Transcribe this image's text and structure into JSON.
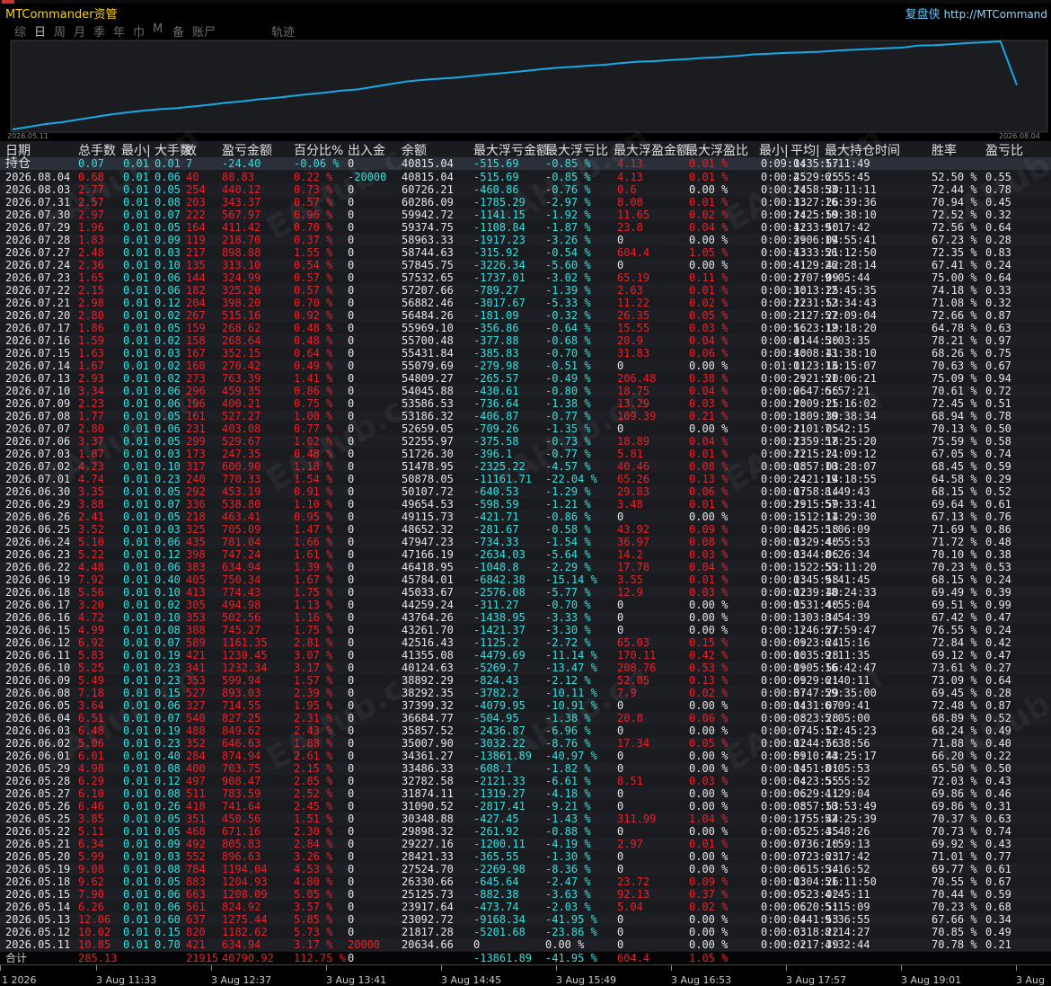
{
  "header": {
    "app_title": "MTCommander资管",
    "brand_name": "复盘侠",
    "brand_url": "http://MTCommand"
  },
  "tabs": [
    "综",
    "日",
    "周",
    "月",
    "季",
    "年",
    "巾",
    "M",
    "备",
    "账尸",
    "轨迹"
  ],
  "active_tab": 1,
  "chart": {
    "start_label": "2026.05.11",
    "end_label": "2026.08.04",
    "line_color": "#17a9e8"
  },
  "columns": [
    "日期",
    "总手数",
    "最小|",
    "大手数",
    "数",
    "盈亏金额",
    "百分比%",
    "出入金",
    "余额",
    "最大浮亏金额",
    "最大浮亏比",
    "最大浮盈金额",
    "最大浮盈比",
    "最小|",
    "平均|",
    "最大持仓时间",
    "胜率",
    "盈亏比"
  ],
  "watermark": "EAHub.cn",
  "hold": [
    "持仓",
    "0.07",
    "0.01",
    "0.01",
    "7",
    "-24.40",
    "-0.06 %",
    "0",
    "40815.04",
    "-515.69",
    "-0.85 %",
    "4.13",
    "0.01 %",
    "0:09:14",
    "0:35:57",
    "1:11:49",
    "",
    ""
  ],
  "rows": [
    [
      "2026.08.04",
      "0.68",
      "0.01",
      "0.06",
      "40",
      "88.83",
      "0.22 %",
      "-20000",
      "40815.04",
      "-515.69",
      "-0.85 %",
      "4.13",
      "0.01 %",
      "0:00:45",
      "2:29:25",
      "6:55:45",
      "52.50 %",
      "0.55"
    ],
    [
      "2026.08.03",
      "2.77",
      "0.01",
      "0.05",
      "254",
      "440.12",
      "0.73 %",
      "0",
      "60726.21",
      "-460.86",
      "-0.76 %",
      "0.6",
      "0.00 %",
      "0:00:24",
      "1:58:30",
      "53:11:11",
      "72.44 %",
      "0.78"
    ],
    [
      "2026.07.31",
      "2.57",
      "0.01",
      "0.08",
      "203",
      "343.37",
      "0.57 %",
      "0",
      "60286.09",
      "-1785.29",
      "-2.97 %",
      "8.08",
      "0.01 %",
      "0:00:33",
      "1:27:26",
      "16:39:36",
      "70.94 %",
      "0.45"
    ],
    [
      "2026.07.30",
      "2.97",
      "0.01",
      "0.07",
      "222",
      "567.97",
      "0.96 %",
      "0",
      "59942.72",
      "-1141.15",
      "-1.92 %",
      "11.65",
      "0.02 %",
      "0:00:24",
      "1:25:59",
      "10:38:10",
      "72.52 %",
      "0.32"
    ],
    [
      "2026.07.29",
      "1.96",
      "0.01",
      "0.05",
      "164",
      "411.42",
      "0.70 %",
      "0",
      "59374.75",
      "-1108.84",
      "-1.87 %",
      "23.8",
      "0.04 %",
      "0:00:42",
      "1:33:50",
      "9:17:42",
      "72.56 %",
      "0.64"
    ],
    [
      "2026.07.28",
      "1.83",
      "0.01",
      "0.09",
      "119",
      "218.70",
      "0.37 %",
      "0",
      "58963.33",
      "-1917.23",
      "-3.26 %",
      "0",
      "0.00 %",
      "0:00:29",
      "3:06:04",
      "19:55:41",
      "67.23 %",
      "0.28"
    ],
    [
      "2026.07.27",
      "2.48",
      "0.01",
      "0.03",
      "217",
      "898.88",
      "1.55 %",
      "0",
      "58744.63",
      "-315.92",
      "-0.54 %",
      "604.4",
      "1.05 %",
      "0:00:13",
      "4:33:21",
      "56:12:50",
      "72.35 %",
      "0.83"
    ],
    [
      "2026.07.24",
      "2.36",
      "0.01",
      "0.10",
      "135",
      "313.10",
      "0.54 %",
      "0",
      "57845.75",
      "-3226.34",
      "-5.60 %",
      "0",
      "0.00 %",
      "0:00:41",
      "4:29:42",
      "26:28:14",
      "67.41 %",
      "0.24"
    ],
    [
      "2026.07.23",
      "1.65",
      "0.01",
      "0.06",
      "144",
      "324.99",
      "0.57 %",
      "0",
      "57532.65",
      "-1737.01",
      "-3.02 %",
      "65.19",
      "0.11 %",
      "0:00:27",
      "1:07:09",
      "9:05:44",
      "75.00 %",
      "0.64"
    ],
    [
      "2026.07.22",
      "2.15",
      "0.01",
      "0.06",
      "182",
      "325.20",
      "0.57 %",
      "0",
      "57207.66",
      "-789.27",
      "-1.39 %",
      "2.63",
      "0.01 %",
      "0:00:30",
      "1:13:25",
      "12:45:35",
      "74.18 %",
      "0.33"
    ],
    [
      "2026.07.21",
      "2.98",
      "0.01",
      "0.12",
      "204",
      "398.20",
      "0.70 %",
      "0",
      "56882.46",
      "-3017.67",
      "-5.33 %",
      "11.22",
      "0.02 %",
      "0:00:22",
      "1:31:53",
      "12:34:43",
      "71.08 %",
      "0.32"
    ],
    [
      "2026.07.20",
      "2.80",
      "0.01",
      "0.02",
      "267",
      "515.16",
      "0.92 %",
      "0",
      "56484.26",
      "-181.09",
      "-0.32 %",
      "26.35",
      "0.05 %",
      "0:00:21",
      "2:27:22",
      "57:09:04",
      "72.66 %",
      "0.87"
    ],
    [
      "2026.07.17",
      "1.86",
      "0.01",
      "0.05",
      "159",
      "268.62",
      "0.48 %",
      "0",
      "55969.10",
      "-356.86",
      "-0.64 %",
      "15.55",
      "0.03 %",
      "0:00:56",
      "1:23:19",
      "12:18:20",
      "64.78 %",
      "0.63"
    ],
    [
      "2026.07.16",
      "1.59",
      "0.01",
      "0.02",
      "158",
      "268.64",
      "0.48 %",
      "0",
      "55700.48",
      "-377.88",
      "-0.68 %",
      "20.9",
      "0.04 %",
      "0:00:41",
      "0:44:30",
      "5:03:35",
      "78.21 %",
      "0.97"
    ],
    [
      "2026.07.15",
      "1.63",
      "0.01",
      "0.03",
      "167",
      "352.15",
      "0.64 %",
      "0",
      "55431.84",
      "-385.83",
      "-0.70 %",
      "31.83",
      "0.06 %",
      "0:00:40",
      "1:08:41",
      "13:38:10",
      "68.26 %",
      "0.75"
    ],
    [
      "2026.07.14",
      "1.67",
      "0.01",
      "0.02",
      "160",
      "270.42",
      "0.49 %",
      "0",
      "55079.69",
      "-279.98",
      "-0.51 %",
      "0",
      "0.00 %",
      "0:01:01",
      "1:23:16",
      "13:15:07",
      "70.63 %",
      "0.67"
    ],
    [
      "2026.07.13",
      "2.93",
      "0.01",
      "0.02",
      "273",
      "763.39",
      "1.41 %",
      "0",
      "54809.27",
      "-265.57",
      "-0.49 %",
      "206.48",
      "0.38 %",
      "0:00:29",
      "2:21:20",
      "51:06:21",
      "75.09 %",
      "0.94"
    ],
    [
      "2026.07.10",
      "3.34",
      "0.01",
      "0.06",
      "296",
      "459.35",
      "0.86 %",
      "0",
      "54045.88",
      "-430.61",
      "-0.80 %",
      "18.75",
      "0.04 %",
      "0:00:26",
      "0:47:56",
      "6:57:21",
      "70.61 %",
      "0.72"
    ],
    [
      "2026.07.09",
      "2.23",
      "0.01",
      "0.06",
      "196",
      "400.21",
      "0.75 %",
      "0",
      "53586.53",
      "-736.64",
      "-1.38 %",
      "13.29",
      "0.03 %",
      "0:00:20",
      "1:09:25",
      "11:16:02",
      "72.45 %",
      "0.51"
    ],
    [
      "2026.07.08",
      "1.77",
      "0.01",
      "0.05",
      "161",
      "527.27",
      "1.00 %",
      "0",
      "53186.32",
      "-406.87",
      "-0.77 %",
      "109.39",
      "0.21 %",
      "0:00:18",
      "1:09:39",
      "10:38:34",
      "68.94 %",
      "0.78"
    ],
    [
      "2026.07.07",
      "2.80",
      "0.01",
      "0.06",
      "231",
      "403.08",
      "0.77 %",
      "0",
      "52659.05",
      "-709.26",
      "-1.35 %",
      "0",
      "0.00 %",
      "0:00:21",
      "1:01:05",
      "7:42:15",
      "70.13 %",
      "0.50"
    ],
    [
      "2026.07.06",
      "3.37",
      "0.01",
      "0.05",
      "299",
      "529.67",
      "1.02 %",
      "0",
      "52255.97",
      "-375.58",
      "-0.73 %",
      "18.89",
      "0.04 %",
      "0:00:23",
      "1:59:18",
      "57:25:20",
      "75.59 %",
      "0.58"
    ],
    [
      "2026.07.03",
      "1.87",
      "0.01",
      "0.03",
      "173",
      "247.35",
      "0.48 %",
      "0",
      "51726.30",
      "-396.1",
      "-0.77 %",
      "5.81",
      "0.01 %",
      "0:00:22",
      "1:15:21",
      "14:09:12",
      "67.05 %",
      "0.74"
    ],
    [
      "2026.07.02",
      "4.23",
      "0.01",
      "0.10",
      "317",
      "600.90",
      "1.18 %",
      "0",
      "51478.95",
      "-2325.22",
      "-4.57 %",
      "40.46",
      "0.08 %",
      "0:00:18",
      "0:57:03",
      "10:28:07",
      "68.45 %",
      "0.59"
    ],
    [
      "2026.07.01",
      "4.74",
      "0.01",
      "0.23",
      "240",
      "770.33",
      "1.54 %",
      "0",
      "50878.05",
      "-11161.71",
      "-22.04 %",
      "65.26",
      "0.13 %",
      "0:00:24",
      "2:21:14",
      "19:18:55",
      "64.58 %",
      "0.29"
    ],
    [
      "2026.06.30",
      "3.35",
      "0.01",
      "0.05",
      "292",
      "453.19",
      "0.91 %",
      "0",
      "50107.72",
      "-640.53",
      "-1.29 %",
      "29.83",
      "0.06 %",
      "0:00:17",
      "0:58:14",
      "8:49:43",
      "68.15 %",
      "0.52"
    ],
    [
      "2026.06.29",
      "3.88",
      "0.01",
      "0.07",
      "336",
      "538.80",
      "1.10 %",
      "0",
      "49654.53",
      "-598.59",
      "-1.21 %",
      "3.48",
      "0.01 %",
      "0:00:19",
      "2:15:59",
      "57:33:41",
      "69.64 %",
      "0.61"
    ],
    [
      "2026.06.26",
      "2.41",
      "0.01",
      "0.05",
      "218",
      "463.41",
      "0.95 %",
      "0",
      "49115.73",
      "-421.71",
      "-0.86 %",
      "0",
      "0.00 %",
      "0:00:15",
      "1:12:14",
      "11:29:30",
      "67.13 %",
      "0.76"
    ],
    [
      "2026.06.25",
      "3.52",
      "0.01",
      "0.03",
      "325",
      "705.09",
      "1.47 %",
      "0",
      "48652.32",
      "-281.67",
      "-0.58 %",
      "43.92",
      "0.09 %",
      "0:00:14",
      "0:25:18",
      "5:06:09",
      "71.69 %",
      "0.86"
    ],
    [
      "2026.06.24",
      "5.10",
      "0.01",
      "0.06",
      "435",
      "781.04",
      "1.66 %",
      "0",
      "47947.23",
      "-734.33",
      "-1.54 %",
      "36.97",
      "0.08 %",
      "0:00:13",
      "0:29:40",
      "4:55:53",
      "71.72 %",
      "0.48"
    ],
    [
      "2026.06.23",
      "5.22",
      "0.01",
      "0.12",
      "398",
      "747.24",
      "1.61 %",
      "0",
      "47166.19",
      "-2634.03",
      "-5.64 %",
      "14.2",
      "0.03 %",
      "0:00:13",
      "0:44:06",
      "8:26:34",
      "70.10 %",
      "0.38"
    ],
    [
      "2026.06.22",
      "4.48",
      "0.01",
      "0.06",
      "383",
      "634.94",
      "1.39 %",
      "0",
      "46418.95",
      "-1048.8",
      "-2.29 %",
      "17.78",
      "0.04 %",
      "0:00:15",
      "1:22:53",
      "55:11:20",
      "70.23 %",
      "0.53"
    ],
    [
      "2026.06.19",
      "7.92",
      "0.01",
      "0.40",
      "405",
      "750.34",
      "1.67 %",
      "0",
      "45784.01",
      "-6842.38",
      "-15.14 %",
      "3.55",
      "0.01 %",
      "0:00:13",
      "0:45:58",
      "9:41:45",
      "68.15 %",
      "0.24"
    ],
    [
      "2026.06.18",
      "5.56",
      "0.01",
      "0.10",
      "413",
      "774.43",
      "1.75 %",
      "0",
      "45033.67",
      "-2576.08",
      "-5.77 %",
      "12.9",
      "0.03 %",
      "0:00:12",
      "0:39:40",
      "18:24:33",
      "69.49 %",
      "0.39"
    ],
    [
      "2026.06.17",
      "3.20",
      "0.01",
      "0.02",
      "305",
      "494.98",
      "1.13 %",
      "0",
      "44259.24",
      "-311.27",
      "-0.70 %",
      "0",
      "0.00 %",
      "0:00:15",
      "0:31:40",
      "4:55:04",
      "69.51 %",
      "0.99"
    ],
    [
      "2026.06.16",
      "4.72",
      "0.01",
      "0.10",
      "353",
      "502.56",
      "1.16 %",
      "0",
      "43764.26",
      "-1438.95",
      "-3.33 %",
      "0",
      "0.00 %",
      "0:00:13",
      "1:03:34",
      "8:54:39",
      "67.42 %",
      "0.47"
    ],
    [
      "2026.06.15",
      "4.99",
      "0.01",
      "0.08",
      "388",
      "745.27",
      "1.75 %",
      "0",
      "43261.70",
      "-1421.37",
      "-3.30 %",
      "0",
      "0.00 %",
      "0:00:12",
      "1:46:27",
      "57:59:47",
      "76.55 %",
      "0.24"
    ],
    [
      "2026.06.12",
      "6.92",
      "0.01",
      "0.07",
      "589",
      "1161.35",
      "2.81 %",
      "0",
      "42516.43",
      "-1125.2",
      "-2.72 %",
      "65.03",
      "0.15 %",
      "0:00:09",
      "0:23:24",
      "6:15:16",
      "72.84 %",
      "0.42"
    ],
    [
      "2026.06.11",
      "5.83",
      "0.01",
      "0.19",
      "421",
      "1230.45",
      "3.07 %",
      "0",
      "41355.08",
      "-4479.69",
      "-11.14 %",
      "170.11",
      "0.42 %",
      "0:00:10",
      "0:35:28",
      "9:11:35",
      "69.12 %",
      "0.47"
    ],
    [
      "2026.06.10",
      "5.25",
      "0.01",
      "0.23",
      "341",
      "1232.34",
      "3.17 %",
      "0",
      "40124.63",
      "-5269.7",
      "-13.47 %",
      "208.76",
      "0.53 %",
      "0:00:09",
      "1:05:56",
      "16:42:47",
      "73.61 %",
      "0.27"
    ],
    [
      "2026.06.09",
      "5.49",
      "0.01",
      "0.23",
      "353",
      "599.94",
      "1.57 %",
      "0",
      "38892.29",
      "-824.43",
      "-2.12 %",
      "52.05",
      "0.13 %",
      "0:00:09",
      "0:29:21",
      "6:40:11",
      "73.09 %",
      "0.64"
    ],
    [
      "2026.06.08",
      "7.18",
      "0.01",
      "0.15",
      "527",
      "893.03",
      "2.39 %",
      "0",
      "38292.35",
      "-3782.2",
      "-10.11 %",
      "7.9",
      "0.02 %",
      "0:00:07",
      "3:47:29",
      "59:35:00",
      "69.45 %",
      "0.28"
    ],
    [
      "2026.06.05",
      "3.64",
      "0.01",
      "0.06",
      "327",
      "714.55",
      "1.95 %",
      "0",
      "37399.32",
      "-4079.95",
      "-10.91 %",
      "0",
      "0.00 %",
      "0:00:14",
      "0:31:07",
      "6:09:41",
      "72.48 %",
      "0.87"
    ],
    [
      "2026.06.04",
      "6.51",
      "0.01",
      "0.07",
      "540",
      "827.25",
      "2.31 %",
      "0",
      "36684.77",
      "-504.95",
      "-1.38 %",
      "20.8",
      "0.06 %",
      "0:00:08",
      "0:23:28",
      "5:05:00",
      "68.89 %",
      "0.52"
    ],
    [
      "2026.06.03",
      "6.48",
      "0.01",
      "0.19",
      "488",
      "849.62",
      "2.43 %",
      "0",
      "35857.52",
      "-2436.87",
      "-6.96 %",
      "0",
      "0.00 %",
      "0:00:07",
      "0:45:52",
      "11:45:23",
      "68.24 %",
      "0.49"
    ],
    [
      "2026.06.02",
      "5.06",
      "0.01",
      "0.23",
      "352",
      "646.63",
      "1.88 %",
      "0",
      "35007.90",
      "-3032.22",
      "-8.76 %",
      "17.34",
      "0.05 %",
      "0:00:12",
      "0:44:56",
      "7:38:56",
      "71.88 %",
      "0.40"
    ],
    [
      "2026.06.01",
      "6.01",
      "0.01",
      "0.40",
      "284",
      "874.94",
      "2.61 %",
      "0",
      "34361.27",
      "-13861.89",
      "-40.97 %",
      "0",
      "0.00 %",
      "0:00:09",
      "5:10:43",
      "74:25:17",
      "66.20 %",
      "0.22"
    ],
    [
      "2026.05.29",
      "4.98",
      "0.01",
      "0.08",
      "400",
      "703.75",
      "2.15 %",
      "0",
      "33486.33",
      "-608.1",
      "-1.82 %",
      "0",
      "0.00 %",
      "0:00:14",
      "0:51:01",
      "8:05:53",
      "65.50 %",
      "0.50"
    ],
    [
      "2026.05.28",
      "6.29",
      "0.01",
      "0.12",
      "497",
      "908.47",
      "2.85 %",
      "0",
      "32782.58",
      "-2121.33",
      "-6.61 %",
      "8.51",
      "0.03 %",
      "0:00:04",
      "0:23:55",
      "5:55:52",
      "72.03 %",
      "0.43"
    ],
    [
      "2026.05.27",
      "6.10",
      "0.01",
      "0.08",
      "511",
      "783.59",
      "2.52 %",
      "0",
      "31874.11",
      "-1319.27",
      "-4.18 %",
      "0",
      "0.00 %",
      "0:00:06",
      "0:29:11",
      "4:29:04",
      "69.86 %",
      "0.46"
    ],
    [
      "2026.05.26",
      "6.46",
      "0.01",
      "0.26",
      "418",
      "741.64",
      "2.45 %",
      "0",
      "31090.52",
      "-2817.41",
      "-9.21 %",
      "0",
      "0.00 %",
      "0:00:08",
      "0:57:53",
      "10:53:49",
      "69.86 %",
      "0.31"
    ],
    [
      "2026.05.25",
      "3.85",
      "0.01",
      "0.05",
      "351",
      "450.56",
      "1.51 %",
      "0",
      "30348.88",
      "-427.45",
      "-1.43 %",
      "311.99",
      "1.04 %",
      "0:00:17",
      "1:55:44",
      "52:25:39",
      "70.37 %",
      "0.63"
    ],
    [
      "2026.05.22",
      "5.11",
      "0.01",
      "0.05",
      "468",
      "671.16",
      "2.30 %",
      "0",
      "29898.32",
      "-261.92",
      "-0.88 %",
      "0",
      "0.00 %",
      "0:00:05",
      "0:25:35",
      "4:48:26",
      "70.73 %",
      "0.74"
    ],
    [
      "2026.05.21",
      "6.34",
      "0.01",
      "0.09",
      "492",
      "805.83",
      "2.84 %",
      "0",
      "29227.16",
      "-1200.11",
      "-4.19 %",
      "2.97",
      "0.01 %",
      "0:00:07",
      "0:36:10",
      "7:59:13",
      "69.92 %",
      "0.43"
    ],
    [
      "2026.05.20",
      "5.99",
      "0.01",
      "0.03",
      "552",
      "896.63",
      "3.26 %",
      "0",
      "28421.33",
      "-365.55",
      "-1.30 %",
      "0",
      "0.00 %",
      "0:00:07",
      "0:23:23",
      "6:17:42",
      "71.01 %",
      "0.77"
    ],
    [
      "2026.05.19",
      "9.08",
      "0.01",
      "0.08",
      "784",
      "1194.04",
      "4.53 %",
      "0",
      "27524.70",
      "-2269.98",
      "-8.36 %",
      "0",
      "0.00 %",
      "0:00:06",
      "0:15:34",
      "5:16:52",
      "69.77 %",
      "0.61"
    ],
    [
      "2026.05.18",
      "9.62",
      "0.01",
      "0.05",
      "883",
      "1204.93",
      "4.80 %",
      "0",
      "26330.66",
      "-645.64",
      "-2.47 %",
      "23.72",
      "0.09 %",
      "0:00:03",
      "1:04:26",
      "51:11:50",
      "70.55 %",
      "0.67"
    ],
    [
      "2026.05.15",
      "7.90",
      "0.01",
      "0.06",
      "663",
      "1208.09",
      "5.05 %",
      "0",
      "25125.73",
      "-882.38",
      "-3.63 %",
      "92.13",
      "0.37 %",
      "0:00:05",
      "0:23:02",
      "4:45:11",
      "70.44 %",
      "0.59"
    ],
    [
      "2026.05.14",
      "6.26",
      "0.01",
      "0.06",
      "561",
      "824.92",
      "3.57 %",
      "0",
      "23917.64",
      "-473.74",
      "-2.03 %",
      "5.04",
      "0.02 %",
      "0:00:06",
      "0:20:51",
      "5:15:09",
      "70.23 %",
      "0.68"
    ],
    [
      "2026.05.13",
      "12.06",
      "0.01",
      "0.60",
      "637",
      "1275.44",
      "5.85 %",
      "0",
      "23092.72",
      "-9168.34",
      "-41.95 %",
      "0",
      "0.00 %",
      "0:00:04",
      "0:41:53",
      "9:36:55",
      "67.66 %",
      "0.34"
    ],
    [
      "2026.05.12",
      "10.02",
      "0.01",
      "0.15",
      "820",
      "1182.62",
      "5.73 %",
      "0",
      "21817.28",
      "-5201.68",
      "-23.86 %",
      "0",
      "0.00 %",
      "0:00:03",
      "0:18:22",
      "8:14:27",
      "70.85 %",
      "0.49"
    ],
    [
      "2026.05.11",
      "10.85",
      "0.01",
      "0.70",
      "421",
      "634.94",
      "3.17 %",
      "20000",
      "20634.66",
      "0",
      "0.00 %",
      "0",
      "0.00 %",
      "0:00:02",
      "0:17:39",
      "4:32:44",
      "70.78 %",
      "0.21"
    ]
  ],
  "total": [
    "合计",
    "285.13",
    "",
    "",
    "21915",
    "40790.92",
    "112.75 %",
    "0",
    "",
    "-13861.89",
    "-41.95 %",
    "604.4",
    "1.05 %",
    "",
    "",
    "",
    "",
    ""
  ],
  "time_axis": [
    "1 2026",
    "3 Aug 11:33",
    "3 Aug 12:37",
    "3 Aug 13:41",
    "3 Aug 14:45",
    "3 Aug 15:49",
    "3 Aug 16:53",
    "3 Aug 17:57",
    "3 Aug 19:01",
    "3 Aug"
  ],
  "colors": {
    "positive": "#e8202a",
    "negative": "#33e0e0",
    "neutral": "#e6e6e6",
    "accent": "#ffd400"
  }
}
